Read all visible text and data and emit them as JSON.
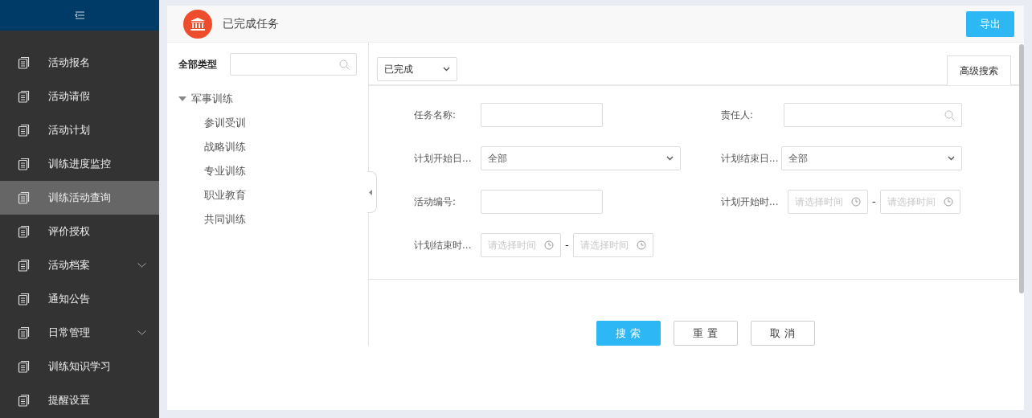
{
  "sidebar": {
    "items": [
      {
        "label": "活动报名",
        "selected": false,
        "has_submenu": false
      },
      {
        "label": "活动请假",
        "selected": false,
        "has_submenu": false
      },
      {
        "label": "活动计划",
        "selected": false,
        "has_submenu": false
      },
      {
        "label": "训练进度监控",
        "selected": false,
        "has_submenu": false
      },
      {
        "label": "训练活动查询",
        "selected": true,
        "has_submenu": false
      },
      {
        "label": "评价授权",
        "selected": false,
        "has_submenu": false
      },
      {
        "label": "活动档案",
        "selected": false,
        "has_submenu": true
      },
      {
        "label": "通知公告",
        "selected": false,
        "has_submenu": false
      },
      {
        "label": "日常管理",
        "selected": false,
        "has_submenu": true
      },
      {
        "label": "训练知识学习",
        "selected": false,
        "has_submenu": false
      },
      {
        "label": "提醒设置",
        "selected": false,
        "has_submenu": false
      }
    ]
  },
  "page": {
    "title": "已完成任务",
    "export_button": "导出"
  },
  "tree": {
    "label": "全部类型",
    "nodes": [
      {
        "label": "军事训练",
        "expanded": true,
        "children": [
          {
            "label": "参训受训"
          },
          {
            "label": "战略训练"
          },
          {
            "label": "专业训练"
          },
          {
            "label": "职业教育"
          },
          {
            "label": "共同训练"
          }
        ]
      }
    ]
  },
  "filter": {
    "status": "已完成",
    "tabs": [
      {
        "label": "高级搜索",
        "selected": true
      }
    ]
  },
  "form": {
    "fields": [
      {
        "kind": "text",
        "label": "任务名称:"
      },
      {
        "kind": "search",
        "label": "责任人:"
      },
      {
        "kind": "select",
        "label": "计划开始日...",
        "value": "全部"
      },
      {
        "kind": "select",
        "label": "计划结束日...",
        "value": "全部"
      },
      {
        "kind": "text",
        "label": "活动编号:"
      },
      {
        "kind": "timerange",
        "label": "计划开始时...",
        "placeholder_from": "请选择时间",
        "separator": "-",
        "placeholder_to": "请选择时间"
      },
      {
        "kind": "timerange",
        "label": "计划结束时...",
        "placeholder_from": "请选择时间",
        "separator": "-",
        "placeholder_to": "请选择时间"
      }
    ],
    "buttons": [
      {
        "label": "搜 索",
        "kind": "primary"
      },
      {
        "label": "重 置",
        "kind": "default"
      },
      {
        "label": "取 消",
        "kind": "default"
      }
    ]
  }
}
